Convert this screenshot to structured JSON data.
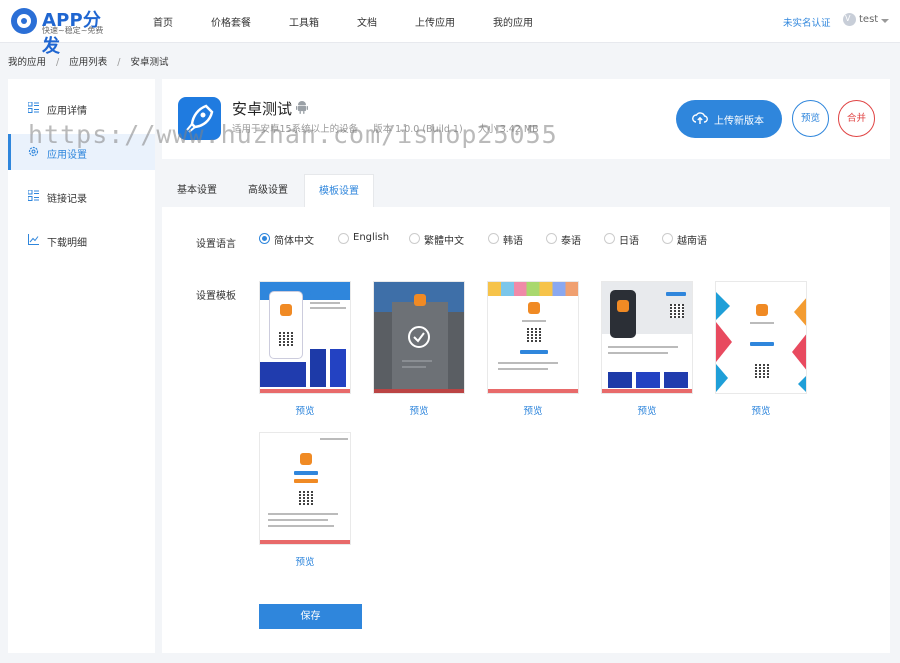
{
  "brand": {
    "name": "APP分发",
    "slogan": "快速~稳定~免费",
    "color": "#1f66d1"
  },
  "nav": {
    "items": [
      "首页",
      "价格套餐",
      "工具箱",
      "文档",
      "上传应用",
      "我的应用"
    ]
  },
  "user": {
    "auth_link": "未实名认证",
    "avatar_letter": "V",
    "name": "test"
  },
  "breadcrumb": {
    "items": [
      "我的应用",
      "应用列表",
      "安卓测试"
    ],
    "separator": "/"
  },
  "sidebar": {
    "items": [
      {
        "label": "应用详情",
        "icon": "list-icon"
      },
      {
        "label": "应用设置",
        "icon": "gear-icon"
      },
      {
        "label": "链接记录",
        "icon": "list-icon"
      },
      {
        "label": "下载明细",
        "icon": "chart-icon"
      }
    ],
    "active_index": 1
  },
  "app": {
    "name": "安卓测试",
    "platform_icon": "android-icon",
    "requirement": "适用于安卓15系统以上的设备",
    "version": "版本 1.0.0 (Build 1)",
    "size": "大小  3.42 MB"
  },
  "actions": {
    "upload": "上传新版本",
    "preview": "预览",
    "merge": "合并"
  },
  "tabs": {
    "items": [
      "基本设置",
      "高级设置",
      "模板设置"
    ],
    "active_index": 2
  },
  "settings": {
    "language_label": "设置语言",
    "languages": [
      "简体中文",
      "English",
      "繁體中文",
      "韩语",
      "泰语",
      "日语",
      "越南语"
    ],
    "selected_language": "简体中文",
    "template_label": "设置模板",
    "templates": [
      {
        "link": "预览"
      },
      {
        "link": "预览",
        "selected": true
      },
      {
        "link": "预览"
      },
      {
        "link": "预览"
      },
      {
        "link": "预览"
      },
      {
        "link": "预览"
      }
    ],
    "save_label": "保存"
  },
  "watermark": "https://www.huzhan.com/ishop25055",
  "colors": {
    "accent": "#2f86dc",
    "danger": "#e04444",
    "background": "#f3f5f8"
  }
}
